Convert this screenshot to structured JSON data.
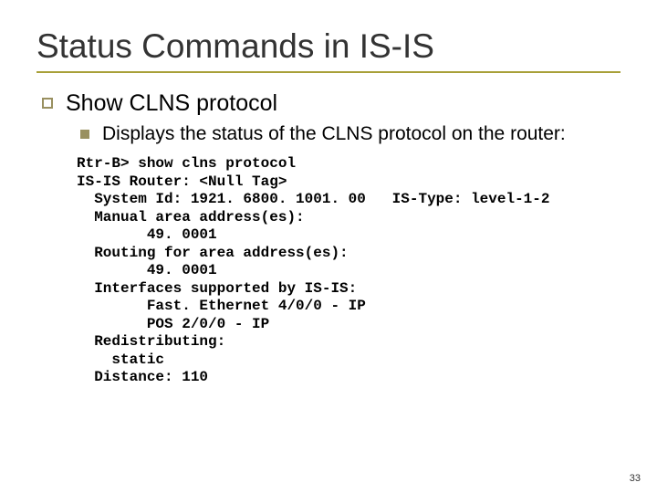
{
  "title": "Status Commands in IS-IS",
  "bullets": {
    "lvl1": "Show CLNS protocol",
    "lvl2": "Displays the status of the CLNS protocol on the router:"
  },
  "console": "Rtr-B> show clns protocol\nIS-IS Router: <Null Tag>\n  System Id: 1921. 6800. 1001. 00   IS-Type: level-1-2\n  Manual area address(es):\n        49. 0001\n  Routing for area address(es):\n        49. 0001\n  Interfaces supported by IS-IS:\n        Fast. Ethernet 4/0/0 - IP\n        POS 2/0/0 - IP\n  Redistributing:\n    static\n  Distance: 110",
  "page_number": "33"
}
